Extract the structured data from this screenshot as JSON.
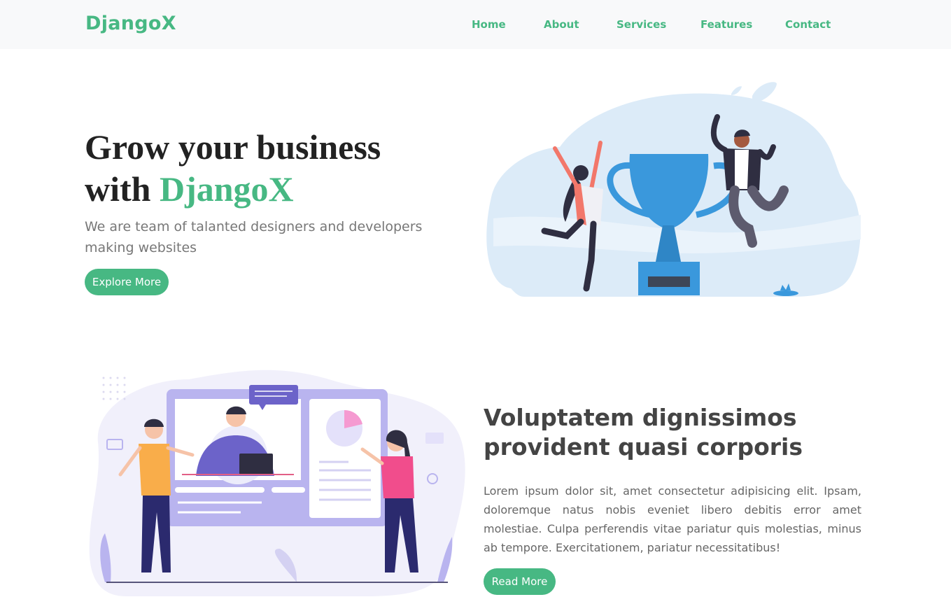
{
  "navbar": {
    "brand": "DjangoX",
    "links": [
      {
        "label": "Home"
      },
      {
        "label": "About"
      },
      {
        "label": "Services"
      },
      {
        "label": "Features"
      },
      {
        "label": "Contact"
      }
    ]
  },
  "hero": {
    "title_line1": "Grow your business",
    "title_with": "with ",
    "title_brand": "DjangoX",
    "subtitle": "We are team of talanted designers and developers making websites",
    "button_label": "Explore More"
  },
  "about": {
    "title": "Voluptatem dignissimos provident quasi corporis",
    "body": "Lorem ipsum dolor sit, amet consectetur adipisicing elit. Ipsam, doloremque natus nobis eveniet libero debitis error amet molestiae. Culpa perferendis vitae pariatur quis molestias, minus ab tempore. Exercitationem, pariatur necessitatibus!",
    "button_label": "Read More"
  },
  "colors": {
    "accent": "#47b883",
    "navbar_bg": "#f8f9fa",
    "trophy_blue": "#3a98dc",
    "illustration_lavender": "#b9b4ef"
  }
}
